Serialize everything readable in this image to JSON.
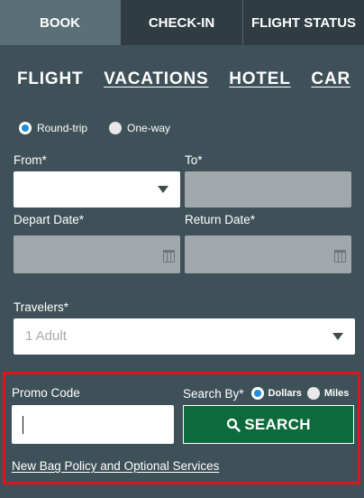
{
  "top_tabs": [
    {
      "label": "BOOK",
      "active": true
    },
    {
      "label": "CHECK-IN",
      "active": false
    },
    {
      "label": "FLIGHT STATUS",
      "active": false
    }
  ],
  "mode_tabs": [
    {
      "label": "FLIGHT",
      "active": true
    },
    {
      "label": "VACATIONS",
      "active": false
    },
    {
      "label": "HOTEL",
      "active": false
    },
    {
      "label": "CAR",
      "active": false
    }
  ],
  "trip_type": {
    "options": [
      {
        "label": "Round-trip",
        "selected": true
      },
      {
        "label": "One-way",
        "selected": false
      }
    ]
  },
  "form": {
    "from_label": "From*",
    "from_value": "",
    "to_label": "To*",
    "to_value": "",
    "depart_label": "Depart Date*",
    "return_label": "Return Date*",
    "travelers_label": "Travelers*",
    "travelers_value": "1 Adult"
  },
  "promo": {
    "promo_label": "Promo Code",
    "promo_value": "",
    "search_by_label": "Search By*",
    "search_by_options": [
      {
        "label": "Dollars",
        "selected": true
      },
      {
        "label": "Miles",
        "selected": false
      }
    ],
    "search_button": "SEARCH",
    "policy_link": "New Bag Policy and Optional Services"
  },
  "colors": {
    "background": "#3f5158",
    "search_button": "#0d6a3c",
    "highlight_border": "#e0141b",
    "radio_selected": "#1c8fd9"
  }
}
